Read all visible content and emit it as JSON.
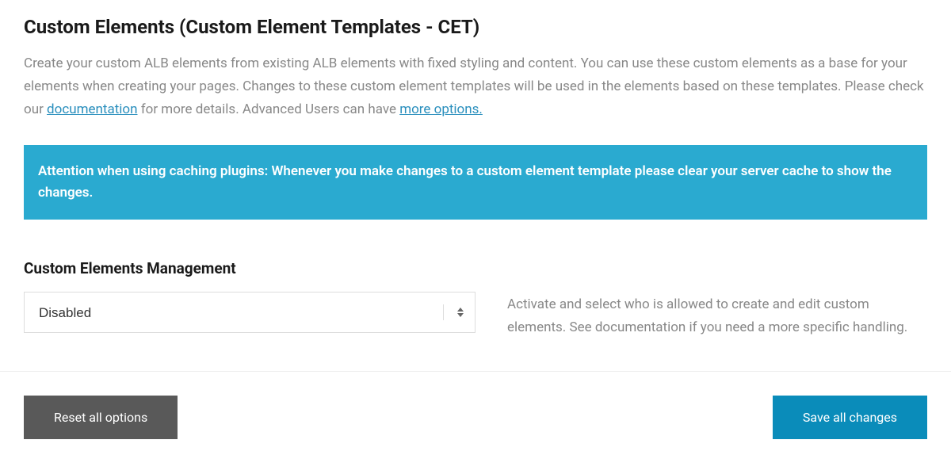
{
  "header": {
    "title": "Custom Elements (Custom Element Templates - CET)"
  },
  "description": {
    "text_before_doc": "Create your custom ALB elements from existing ALB elements with fixed styling and content. You can use these custom elements as a base for your elements when creating your pages. Changes to these custom element templates will be used in the elements based on these templates. Please check our ",
    "doc_link": "documentation",
    "text_mid": " for more details. Advanced Users can have ",
    "more_link": "more options."
  },
  "alert": {
    "message": "Attention when using caching plugins: Whenever you make changes to a custom element template please clear your server cache to show the changes."
  },
  "section": {
    "title": "Custom Elements Management",
    "select_value": "Disabled",
    "help_text": "Activate and select who is allowed to create and edit custom elements. See documentation if you need a more specific handling."
  },
  "buttons": {
    "reset": "Reset all options",
    "save": "Save all changes"
  }
}
